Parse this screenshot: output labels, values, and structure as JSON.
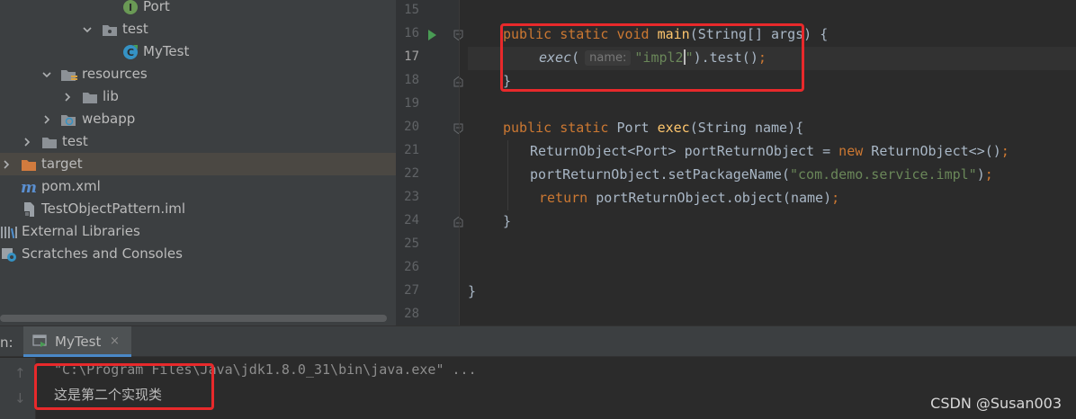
{
  "project_tree": {
    "items": [
      {
        "label": "Port",
        "icon": "interface-icon"
      },
      {
        "label": "test",
        "icon": "package-icon"
      },
      {
        "label": "MyTest",
        "icon": "java-class-icon"
      },
      {
        "label": "resources",
        "icon": "resources-folder-icon"
      },
      {
        "label": "lib",
        "icon": "folder-icon"
      },
      {
        "label": "webapp",
        "icon": "web-folder-icon"
      },
      {
        "label": "test",
        "icon": "folder-icon"
      },
      {
        "label": "target",
        "icon": "excluded-folder-icon"
      },
      {
        "label": "pom.xml",
        "icon": "maven-icon"
      },
      {
        "label": "TestObjectPattern.iml",
        "icon": "iml-file-icon"
      },
      {
        "label": "External Libraries",
        "icon": "libraries-icon"
      },
      {
        "label": "Scratches and Consoles",
        "icon": "scratches-icon"
      }
    ]
  },
  "editor": {
    "line_numbers": [
      "15",
      "16",
      "17",
      "18",
      "19",
      "20",
      "21",
      "22",
      "23",
      "24",
      "25",
      "26",
      "27",
      "28"
    ],
    "code": {
      "l16": {
        "kw1": "public",
        "kw2": "static",
        "kw3": "void",
        "fn": "main",
        "rest": "(String[] args) {"
      },
      "l17": {
        "call": "exec",
        "open": "(",
        "hint": "name:",
        "str_a": "\"impl2",
        "str_b": "\"",
        "rest": ").test()",
        "semi": ";"
      },
      "l18": {
        "text": "}"
      },
      "l20": {
        "kw1": "public",
        "kw2": "static",
        "type": "Port",
        "fn": "exec",
        "rest": "(String name){"
      },
      "l21": {
        "a": "ReturnObject<Port> portReturnObject = ",
        "kw": "new",
        "b": " ReturnObject<>()",
        "semi": ";"
      },
      "l22": {
        "a": "portReturnObject.setPackageName(",
        "str": "\"com.demo.service.impl\"",
        "b": ")",
        "semi": ";"
      },
      "l23": {
        "kw": "return",
        "a": " portReturnObject.object(name)",
        "semi": ";"
      },
      "l24": {
        "text": "}"
      },
      "l27": {
        "text": "}"
      }
    }
  },
  "run_panel": {
    "label": "n:",
    "tab_label": "MyTest",
    "close_glyph": "×",
    "up_glyph": "↑",
    "down_glyph": "↓",
    "command_line": "\"C:\\Program Files\\Java\\jdk1.8.0_31\\bin\\java.exe\" ...",
    "output_line": "这是第二个实现类"
  },
  "watermark": "CSDN @Susan003",
  "colors": {
    "annotation": "#e8292b",
    "keyword": "#cc7832",
    "function": "#ffc66d",
    "string": "#6a8759"
  }
}
